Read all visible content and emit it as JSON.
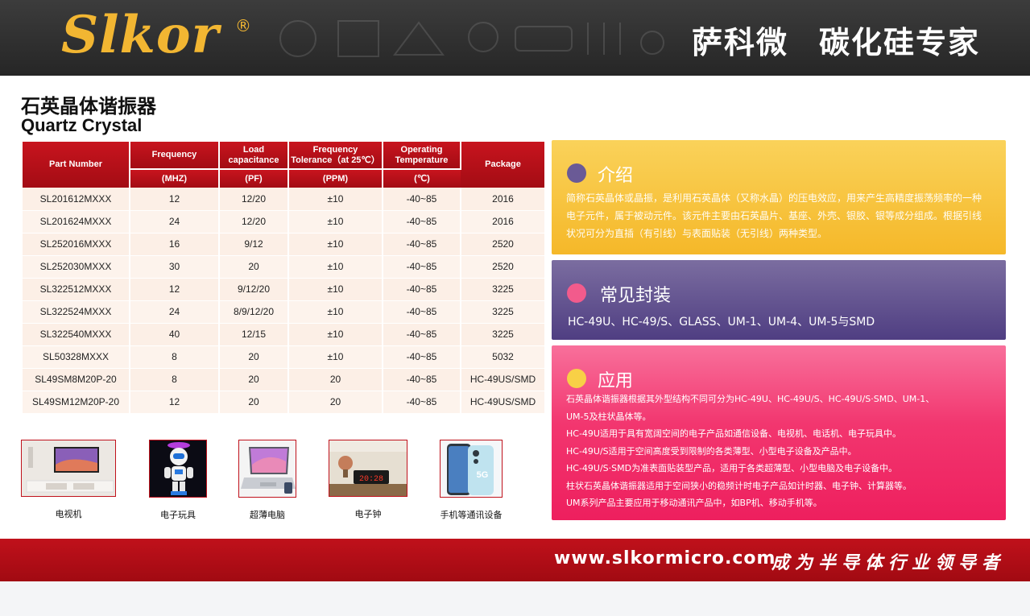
{
  "header": {
    "brand": "Slkor",
    "registered_mark": "®",
    "tagline_cn_1": "萨科微",
    "tagline_cn_2": "碳化硅专家"
  },
  "title": {
    "cn": "石英晶体谐振器",
    "en": "Quartz Crystal"
  },
  "table": {
    "headers": {
      "part_number": "Part Number",
      "frequency": "Frequency",
      "load": "Load\ncapacitance",
      "tolerance": "Frequency\nTolerance（at 25℃）",
      "temperature": "Operating\nTemperature",
      "package": "Package"
    },
    "units": {
      "frequency": "(MHZ)",
      "load": "(PF)",
      "tolerance": "(PPM)",
      "temperature": "(℃)"
    },
    "rows": [
      {
        "part": "SL201612MXXX",
        "freq": "12",
        "load": "12/20",
        "tol": "±10",
        "temp": "-40~85",
        "pkg": "2016"
      },
      {
        "part": "SL201624MXXX",
        "freq": "24",
        "load": "12/20",
        "tol": "±10",
        "temp": "-40~85",
        "pkg": "2016"
      },
      {
        "part": "SL252016MXXX",
        "freq": "16",
        "load": "9/12",
        "tol": "±10",
        "temp": "-40~85",
        "pkg": "2520"
      },
      {
        "part": "SL252030MXXX",
        "freq": "30",
        "load": "20",
        "tol": "±10",
        "temp": "-40~85",
        "pkg": "2520"
      },
      {
        "part": "SL322512MXXX",
        "freq": "12",
        "load": "9/12/20",
        "tol": "±10",
        "temp": "-40~85",
        "pkg": "3225"
      },
      {
        "part": "SL322524MXXX",
        "freq": "24",
        "load": "8/9/12/20",
        "tol": "±10",
        "temp": "-40~85",
        "pkg": "3225"
      },
      {
        "part": "SL322540MXXX",
        "freq": "40",
        "load": "12/15",
        "tol": "±10",
        "temp": "-40~85",
        "pkg": "3225"
      },
      {
        "part": "SL50328MXXX",
        "freq": "8",
        "load": "20",
        "tol": "±10",
        "temp": "-40~85",
        "pkg": "5032"
      },
      {
        "part": "SL49SM8M20P-20",
        "freq": "8",
        "load": "20",
        "tol": "20",
        "temp": "-40~85",
        "pkg": "HC-49US/SMD"
      },
      {
        "part": "SL49SM12M20P-20",
        "freq": "12",
        "load": "20",
        "tol": "20",
        "temp": "-40~85",
        "pkg": "HC-49US/SMD"
      }
    ]
  },
  "applications": [
    {
      "label": "电视机",
      "icon": "tv-icon"
    },
    {
      "label": "电子玩具",
      "icon": "robot-toy-icon"
    },
    {
      "label": "超薄电脑",
      "icon": "laptop-icon"
    },
    {
      "label": "电子钟",
      "icon": "digital-clock-icon",
      "clock_display": "20:28"
    },
    {
      "label": "手机等通讯设备",
      "icon": "smartphone-icon",
      "phone_badge": "5G"
    }
  ],
  "intro": {
    "title": "介绍",
    "text": "简称石英晶体或晶振，是利用石英晶体（又称水晶）的压电效应，用来产生高精度振荡频率的一种电子元件，属于被动元件。该元件主要由石英晶片、基座、外壳、银胶、银等成分组成。根据引线状况可分为直插（有引线）与表面贴装（无引线）两种类型。",
    "dot_color": "#6a5a96"
  },
  "packages": {
    "title": "常见封装",
    "text": "HC-49U、HC-49/S、GLASS、UM-1、UM-4、UM-5与SMD",
    "dot_color": "#f25b8c"
  },
  "usage": {
    "title": "应用",
    "dot_color": "#f8d046",
    "lines": [
      "石英晶体谐振器根据其外型结构不同可分为HC-49U、HC-49U/S、HC-49U/S·SMD、UM-1、",
      "UM-5及柱状晶体等。",
      "HC-49U适用于具有宽阔空间的电子产品如通信设备、电视机、电话机、电子玩具中。",
      "HC-49U/S适用于空间高度受到限制的各类薄型、小型电子设备及产品中。",
      "HC-49U/S·SMD为准表面贴装型产品，适用于各类超薄型、小型电脑及电子设备中。",
      "柱状石英晶体谐振器适用于空间狭小的稳频计时电子产品如计时器、电子钟、计算器等。",
      "UM系列产品主要应用于移动通讯产品中，如BP机、移动手机等。"
    ]
  },
  "footer": {
    "url": "www.slkormicro.com",
    "slogan": "成为半导体行业领导者"
  },
  "colors": {
    "brand_red": "#b50f18",
    "brand_gold": "#f2b632",
    "intro_bg": "#f7c33a",
    "packages_bg": "#5b4b8a",
    "usage_bg": "#f0306b"
  }
}
